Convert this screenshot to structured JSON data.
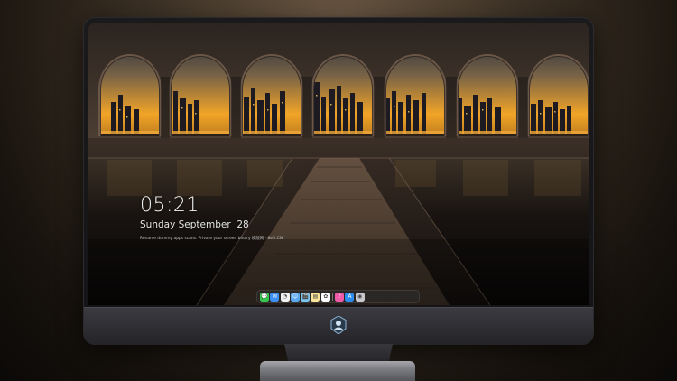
{
  "lock_screen": {
    "time": "05:21",
    "date": "Sunday September  28",
    "notice": "Rename dummy apps scans. Private your screen binary 模版网 · 8shi.CN"
  },
  "dock": {
    "apps": [
      {
        "name": "messages-icon",
        "glyph": "💬",
        "bg": "#37c84e"
      },
      {
        "name": "mail-icon",
        "glyph": "✉",
        "bg": "#3d8ef0"
      },
      {
        "name": "clock-icon",
        "glyph": "◔",
        "bg": "#f2f2f2"
      },
      {
        "name": "finder-icon",
        "glyph": "☺",
        "bg": "#5aa8f0"
      },
      {
        "name": "clapper-icon",
        "glyph": "🎬",
        "bg": "#7bc6ee"
      },
      {
        "name": "notes-icon",
        "glyph": "▤",
        "bg": "#fbe59a"
      },
      {
        "name": "photos-icon",
        "glyph": "✿",
        "bg": "#ffffff"
      },
      {
        "name": "music-icon",
        "glyph": "♪",
        "bg": "#ee5aa8"
      },
      {
        "name": "app-store-icon",
        "glyph": "A",
        "bg": "#2d8cf0"
      },
      {
        "name": "camera-icon",
        "glyph": "◉",
        "bg": "#c9c9cd"
      }
    ]
  },
  "colors": {
    "sky_top": "#2a2a38",
    "sky_sunset": "#f2a427",
    "floor": "#4a3a2e",
    "frame": "#161618",
    "chin": "#2f2f34"
  }
}
